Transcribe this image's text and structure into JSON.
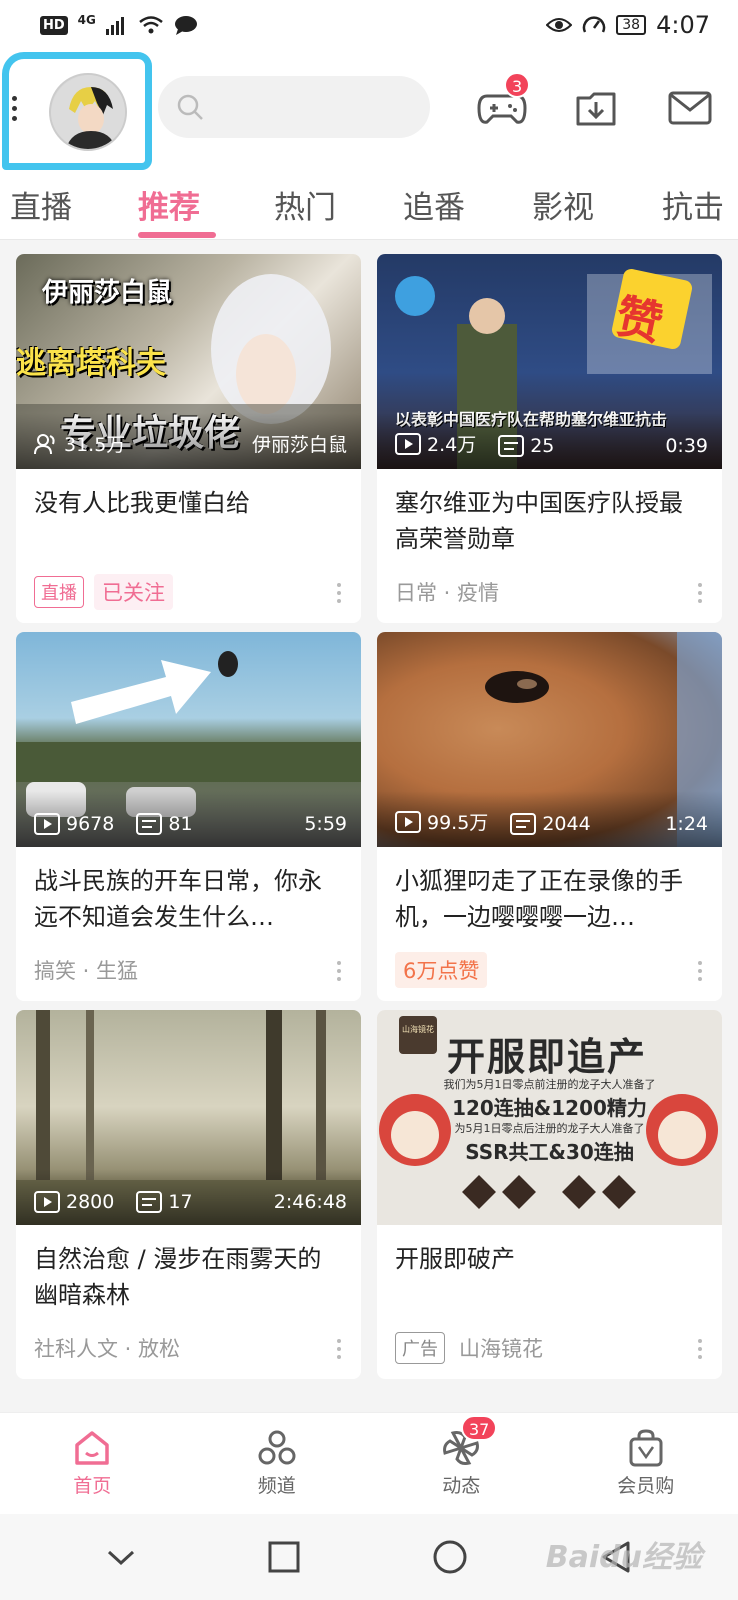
{
  "status_bar": {
    "left_badge": "HD",
    "network": "4G",
    "battery": "38",
    "time": "4:07"
  },
  "header": {
    "search_placeholder": "",
    "game_badge": "3"
  },
  "tabs": [
    {
      "label": "直播",
      "active": false
    },
    {
      "label": "推荐",
      "active": true
    },
    {
      "label": "热门",
      "active": false
    },
    {
      "label": "追番",
      "active": false
    },
    {
      "label": "影视",
      "active": false
    },
    {
      "label": "抗击",
      "active": false
    }
  ],
  "cards": [
    {
      "thumb_text": [
        "伊丽莎白鼠",
        "逃离塔科夫",
        "专业垃圾佬"
      ],
      "stat1": "31.5万",
      "stat1_icon": "person-icon",
      "stat2": "",
      "stat_right": "伊丽莎白鼠",
      "title": "没有人比我更懂白给",
      "tag_live": "直播",
      "tag_followed": "已关注"
    },
    {
      "thumb_text": [
        "以表彰中国医疗队在帮助塞尔维亚抗击",
        "赞"
      ],
      "stat1": "2.4万",
      "stat2": "25",
      "stat_right": "0:39",
      "title": "塞尔维亚为中国医疗队授最高荣誉勋章",
      "meta": "日常 · 疫情"
    },
    {
      "stat1": "9678",
      "stat2": "81",
      "stat_right": "5:59",
      "title": "战斗民族的开车日常，你永远不知道会发生什么…",
      "meta": "搞笑 · 生猛"
    },
    {
      "stat1": "99.5万",
      "stat2": "2044",
      "stat_right": "1:24",
      "title": "小狐狸叼走了正在录像的手机，一边嘤嘤嘤一边…",
      "tag_likes": "6万点赞"
    },
    {
      "stat1": "2800",
      "stat2": "17",
      "stat_right": "2:46:48",
      "title": "自然治愈 / 漫步在雨雾天的幽暗森林",
      "meta": "社科人文 · 放松"
    },
    {
      "thumb_text": [
        "山海镜花",
        "开服即追产",
        "我们为5月1日零点前注册的龙子大人准备了",
        "120连抽&1200精力",
        "为5月1日零点后注册的龙子大人准备了",
        "SSR共工&30连抽"
      ],
      "title": "开服即破产",
      "tag_ad": "广告",
      "meta": "山海镜花"
    }
  ],
  "bottom_nav": [
    {
      "label": "首页",
      "icon": "home-icon",
      "active": true
    },
    {
      "label": "频道",
      "icon": "channel-icon",
      "active": false
    },
    {
      "label": "动态",
      "icon": "dynamic-icon",
      "active": false,
      "badge": "37"
    },
    {
      "label": "会员购",
      "icon": "shopping-bag-icon",
      "active": false
    }
  ],
  "watermark": "Baidu经验"
}
